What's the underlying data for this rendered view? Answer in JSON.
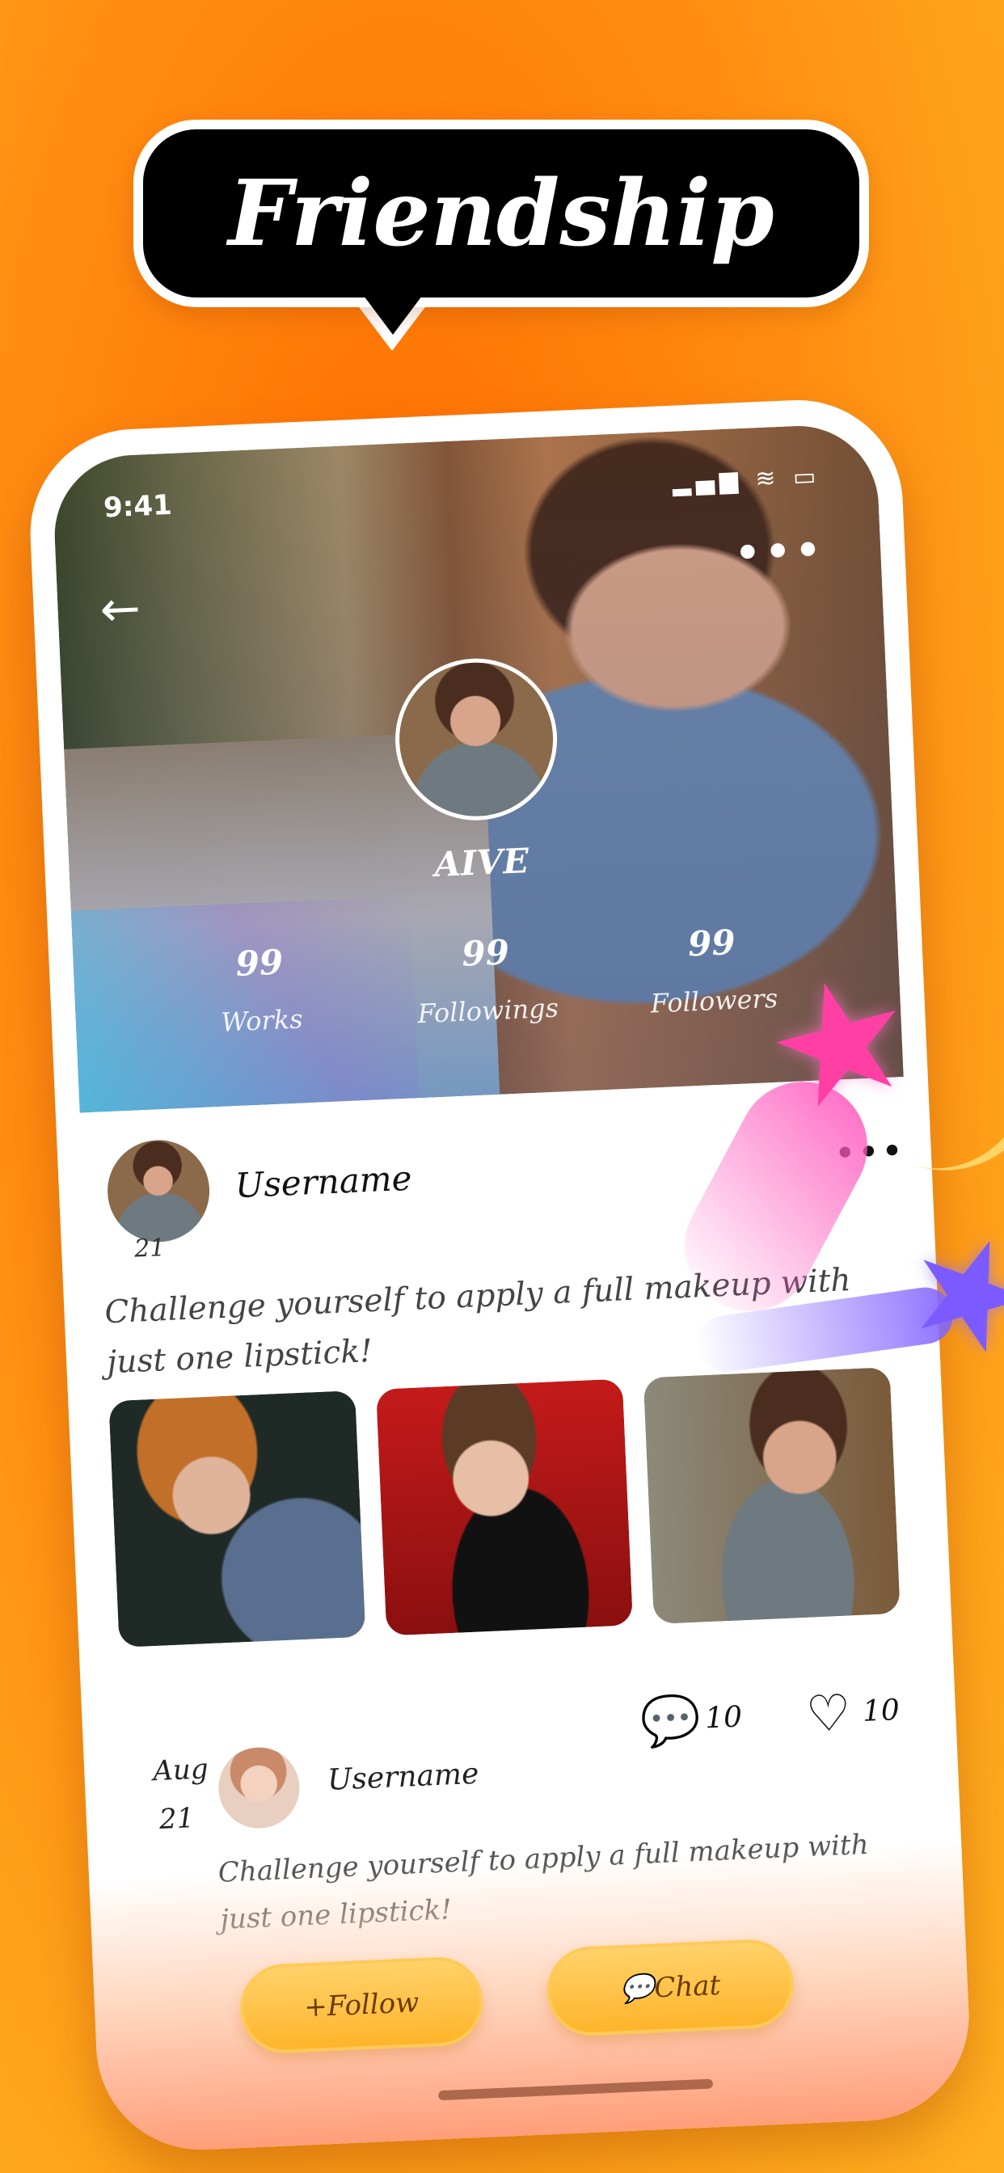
{
  "banner": {
    "title": "Friendship"
  },
  "status_bar": {
    "time": "9:41",
    "icons": "▂▄▆ ≋ ▭"
  },
  "profile": {
    "name": "AIVE",
    "stats": [
      {
        "value": "99",
        "label": "Works"
      },
      {
        "value": "99",
        "label": "Followings"
      },
      {
        "value": "99",
        "label": "Followers"
      }
    ]
  },
  "post1": {
    "username": "Username",
    "day": "21",
    "text": "Challenge yourself to apply a full makeup with just one lipstick!",
    "comments": "10",
    "likes": "10"
  },
  "post2": {
    "month": "Aug",
    "day": "21",
    "username": "Username",
    "text": "Challenge yourself to apply a full makeup with just one lipstick!"
  },
  "actions": {
    "follow_label": "+Follow",
    "chat_label": "💬Chat"
  },
  "icons": {
    "back": "←",
    "more": "•••",
    "comment": "💬",
    "heart": "♡",
    "star": "★"
  },
  "colors": {
    "accent": "#ff8a10",
    "button": "#ffb42a",
    "banner": "#000000"
  }
}
